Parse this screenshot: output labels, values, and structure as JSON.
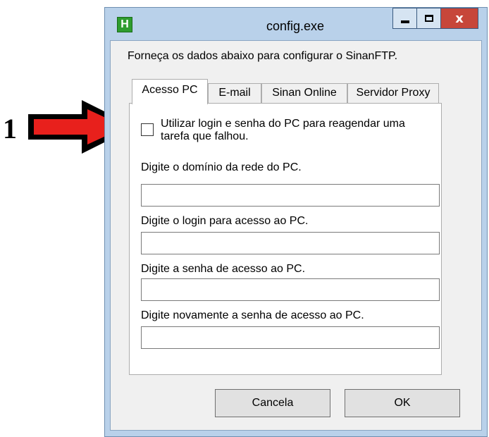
{
  "annotation": {
    "number": "1",
    "arrow_color": "#e8201c"
  },
  "window": {
    "title": "config.exe",
    "app_icon_letter": "H",
    "minimize_symbol": "",
    "close_symbol": "x"
  },
  "intro_text": "Forneça os dados abaixo para configurar o SinanFTP.",
  "tabs": [
    {
      "label": "Acesso PC",
      "active": true
    },
    {
      "label": "E-mail",
      "active": false
    },
    {
      "label": "Sinan Online",
      "active": false
    },
    {
      "label": "Servidor Proxy",
      "active": false
    }
  ],
  "panel": {
    "checkbox_label": "Utilizar login e senha do PC para reagendar uma tarefa que falhou.",
    "checkbox_checked": false,
    "fields": [
      {
        "label": "Digite o domínio da rede do PC.",
        "value": ""
      },
      {
        "label": "Digite o login para acesso ao PC.",
        "value": ""
      },
      {
        "label": "Digite a senha de acesso ao PC.",
        "value": ""
      },
      {
        "label": "Digite novamente a senha de acesso ao PC.",
        "value": ""
      }
    ]
  },
  "buttons": {
    "cancel_label": "Cancela",
    "ok_label": "OK"
  },
  "colors": {
    "window_frame": "#b9d1ea",
    "close_button": "#c7463a",
    "app_icon": "#2e9c2e"
  }
}
